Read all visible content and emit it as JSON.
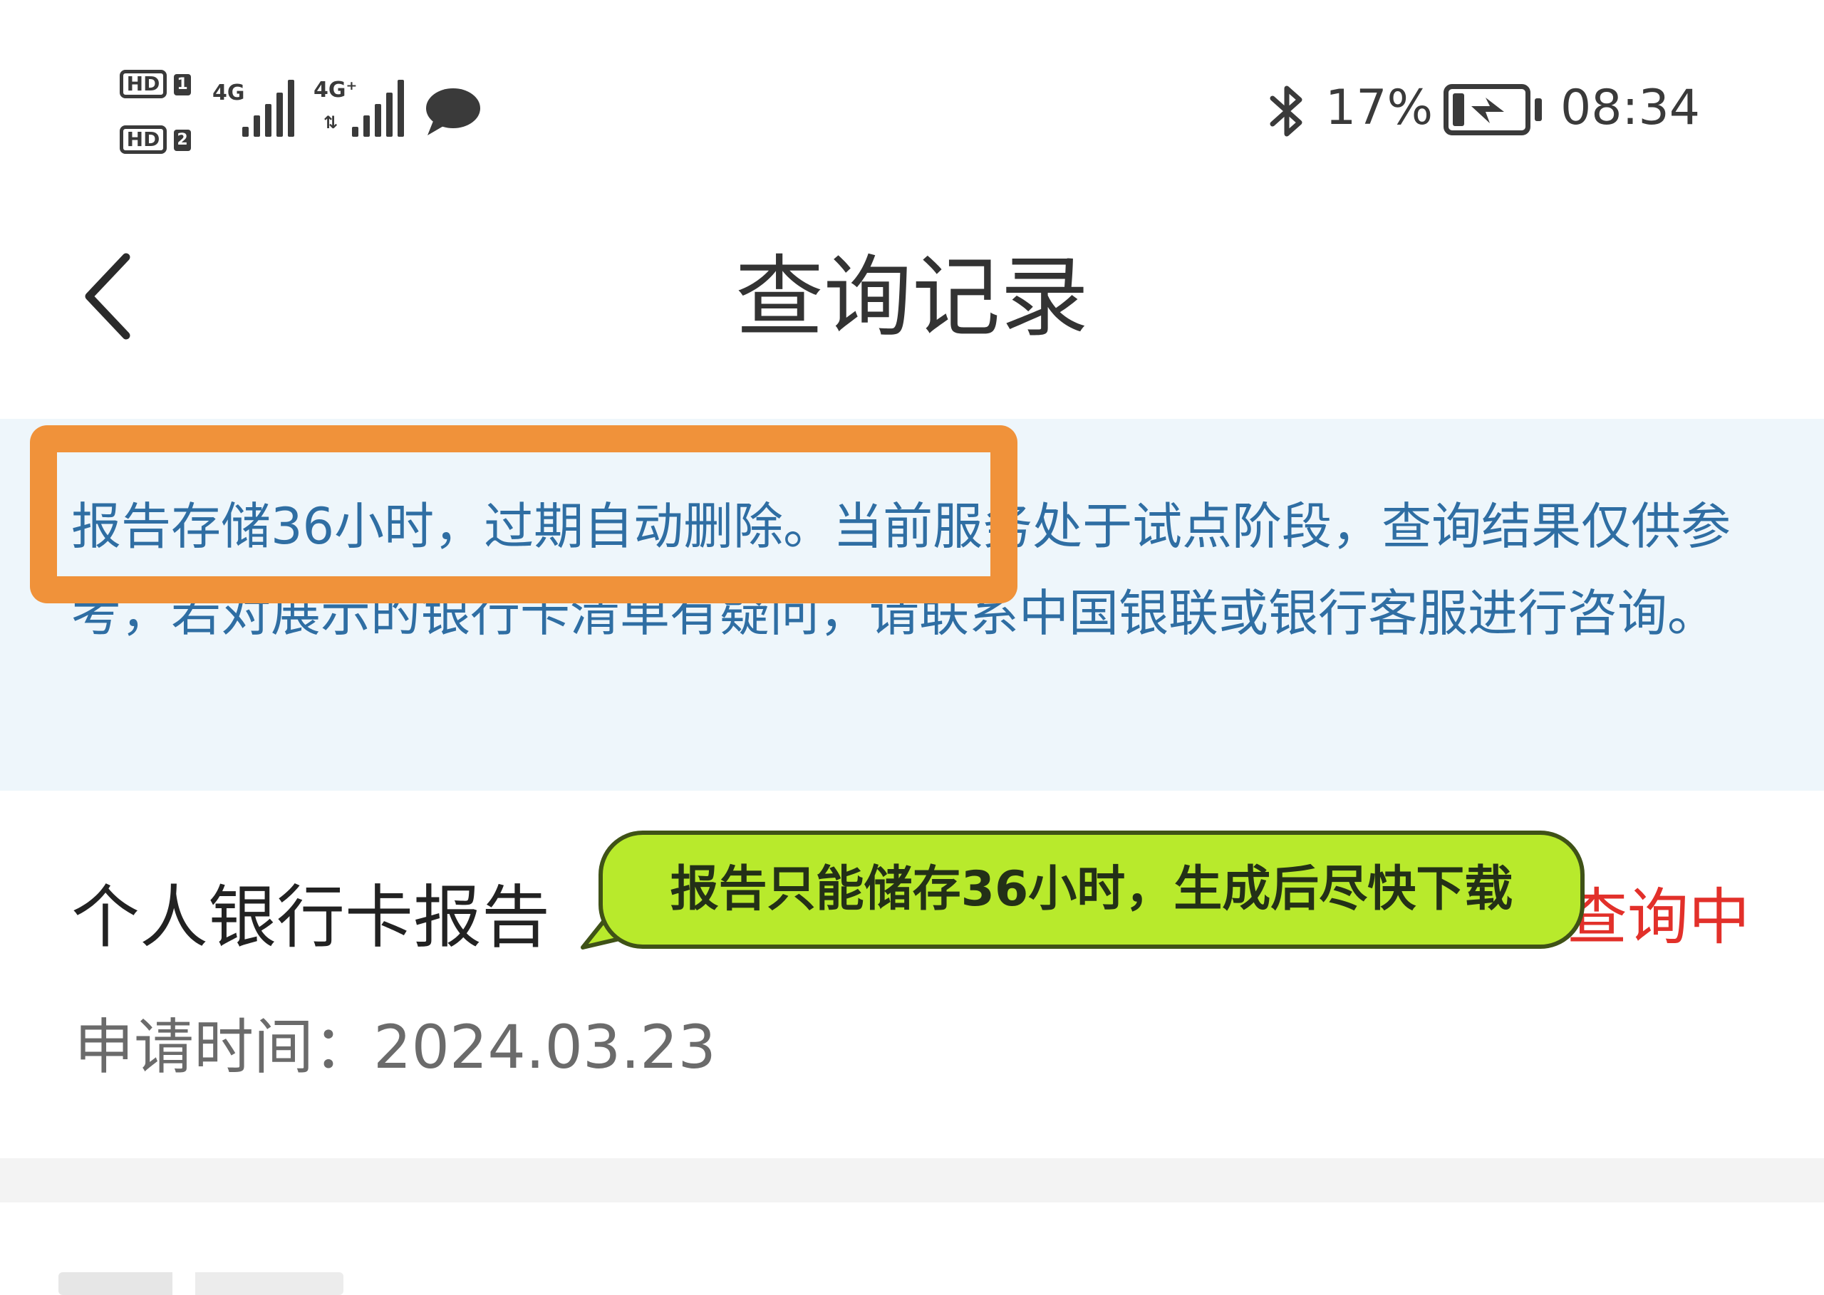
{
  "status_bar": {
    "sim1_label": "HD",
    "sim1_number": "1",
    "sim2_label": "HD",
    "sim2_number": "2",
    "network1": "4G",
    "network2": "4G⁺",
    "network2_arrows": "⇅",
    "battery_percent": "17%",
    "battery_level": 0.17,
    "time": "08:34",
    "icons": [
      "bluetooth-icon",
      "message-icon",
      "charging-icon"
    ]
  },
  "nav": {
    "title": "查询记录",
    "back_icon": "chevron-left-icon"
  },
  "notice": {
    "text": "报告存储36小时，过期自动删除。当前服务处于试点阶段，查询结果仅供参考，若对展示的银行卡清单有疑问，请联系中国银联或银行客服进行咨询。"
  },
  "report": {
    "title": "个人银行卡报告",
    "status": "查询中",
    "apply_time": "申请时间：2024.03.23"
  },
  "annotation": {
    "tooltip_text": "报告只能储存36小时，生成后尽快下载"
  },
  "colors": {
    "notice_bg": "#eef6fb",
    "notice_text": "#2f6ea3",
    "status_red": "#e2302a",
    "highlight_orange": "#f0923a",
    "callout_green": "#b8ea2c"
  }
}
